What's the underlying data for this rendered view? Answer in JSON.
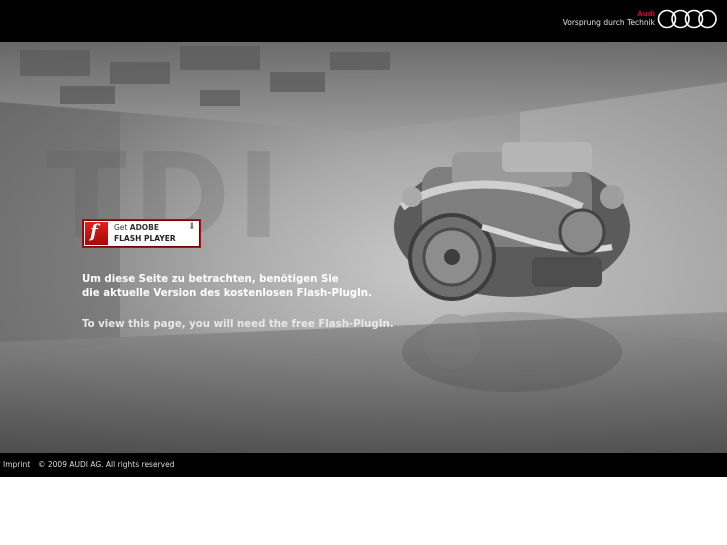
{
  "header": {
    "brand": "Audi",
    "slogan": "Vorsprung durch Technik",
    "logo_icon": "audi-four-rings",
    "brand_color": "#cc0033"
  },
  "hero": {
    "watermark": "TDI",
    "flash_badge": {
      "get": "Get",
      "adobe": "ADOBE",
      "player": "FLASH PLAYER",
      "logo_letter": "f",
      "arrow": "⬇",
      "icon": "flash-logo-icon"
    },
    "message_de_line1": "Um diese Seite zu betrachten, benötigen Sie",
    "message_de_line2": "die aktuelle Version des kostenlosen Flash-PlugIn.",
    "message_en": "To view this page, you will need the free Flash-PlugIn."
  },
  "footer": {
    "imprint": "Imprint",
    "copyright": "© 2009 AUDI AG. All rights reserved"
  }
}
